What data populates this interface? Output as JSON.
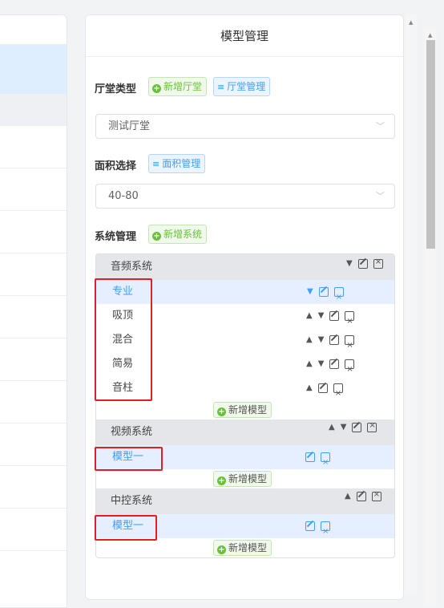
{
  "panel": {
    "title": "模型管理"
  },
  "hall": {
    "label": "厅堂类型",
    "add_label": "新增厅堂",
    "manage_label": "厅堂管理",
    "selected": "测试厅堂"
  },
  "area": {
    "label": "面积选择",
    "manage_label": "面积管理",
    "selected": "40-80"
  },
  "system": {
    "label": "系统管理",
    "add_label": "新增系统"
  },
  "groups": [
    {
      "name": "音频系统",
      "items": [
        "专业",
        "吸顶",
        "混合",
        "简易",
        "音柱"
      ],
      "active_index": 0,
      "add_model_label": "新增模型"
    },
    {
      "name": "视频系统",
      "items": [
        "模型一"
      ],
      "active_index": 0,
      "add_model_label": "新增模型"
    },
    {
      "name": "中控系统",
      "items": [
        "模型一"
      ],
      "active_index": 0,
      "add_model_label": "新增模型"
    }
  ],
  "colors": {
    "accent": "#409eff",
    "success": "#67c23a",
    "highlight": "#e02020"
  },
  "icons": [
    "plus-circle-icon",
    "list-icon",
    "chevron-down-icon",
    "caret-up-icon",
    "caret-down-icon",
    "edit-icon",
    "delete-folder-icon"
  ]
}
